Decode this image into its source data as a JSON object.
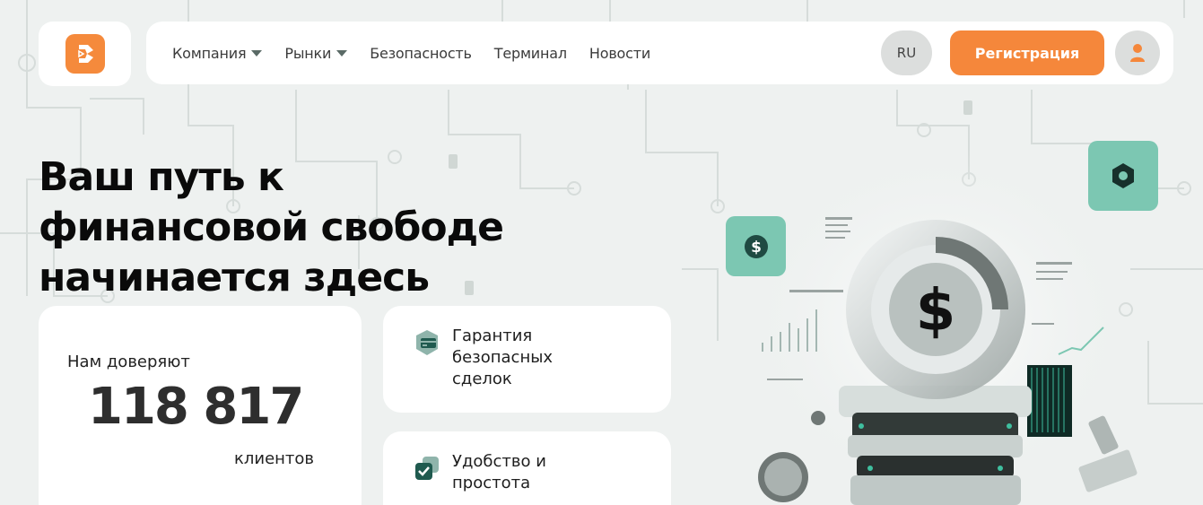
{
  "nav": {
    "items": [
      {
        "label": "Компания",
        "has_dropdown": true
      },
      {
        "label": "Рынки",
        "has_dropdown": true
      },
      {
        "label": "Безопасность",
        "has_dropdown": false
      },
      {
        "label": "Терминал",
        "has_dropdown": false
      },
      {
        "label": "Новости",
        "has_dropdown": false
      }
    ],
    "lang": "RU",
    "register_label": "Регистрация"
  },
  "hero": {
    "title_line1": "Ваш путь к",
    "title_line2": "финансовой свободе",
    "title_line3": "начинается здесь"
  },
  "trust": {
    "label": "Нам доверяют",
    "count": "118 817",
    "unit": "клиентов"
  },
  "features": [
    {
      "line1": "Гарантия",
      "line2": "безопасных",
      "line3": "сделок",
      "icon": "card-shield-icon"
    },
    {
      "line1": "Удобство и",
      "line2": "простота",
      "line3": "",
      "icon": "check-stack-icon"
    }
  ],
  "colors": {
    "accent": "#f5873b",
    "mint": "#7cc7b2",
    "dark_green": "#1f5a4f",
    "background": "#eef1f0"
  }
}
